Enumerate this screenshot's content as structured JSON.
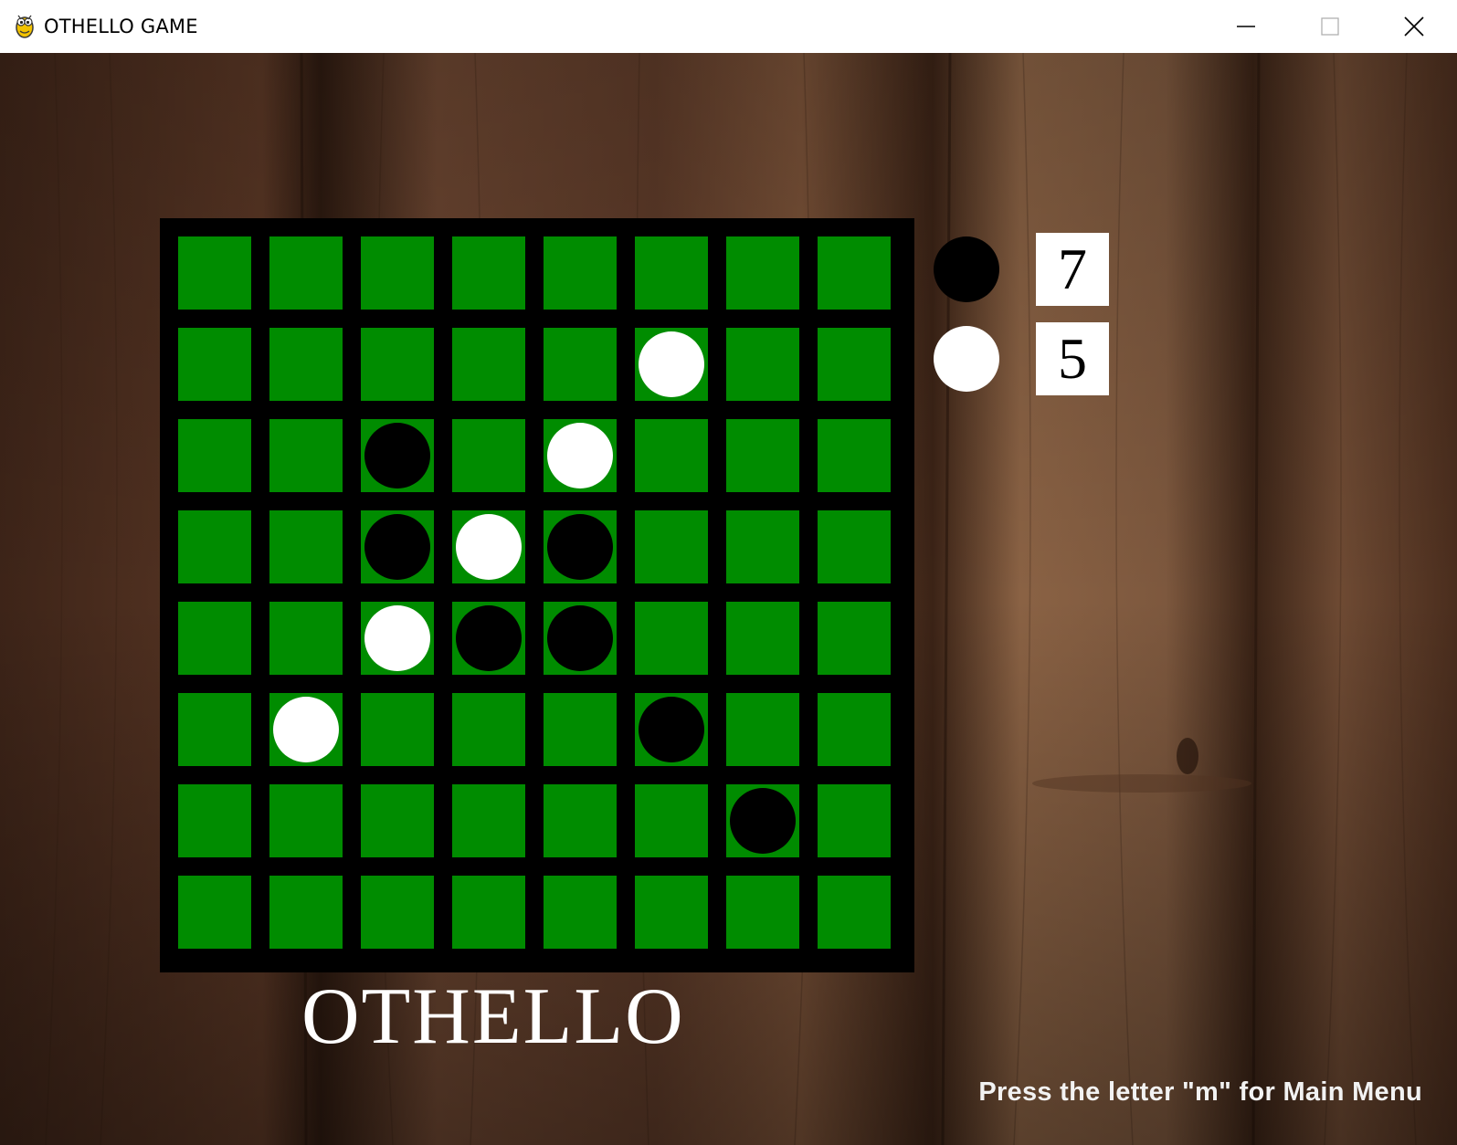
{
  "window": {
    "title": "OTHELLO GAME",
    "icon": "pygame-snake-icon",
    "controls": {
      "minimize": "minimize-icon",
      "maximize": "maximize-icon",
      "close": "close-icon"
    }
  },
  "colors": {
    "board_border": "#000000",
    "cell": "#008c00",
    "black_disc": "#000000",
    "white_disc": "#ffffff",
    "wood_dark": "#3a2215",
    "wood_mid": "#6b4530",
    "wood_light": "#8a6346"
  },
  "board": {
    "size": 8,
    "rows": [
      "--------",
      "-----W--",
      "--B-W---",
      "--BWB---",
      "--WBB---",
      "-W---B--",
      "------B-",
      "--------"
    ],
    "legend": {
      "B": "black",
      "W": "white",
      "-": "empty"
    }
  },
  "score": {
    "black": "7",
    "white": "5"
  },
  "title": "OTHELLO",
  "hint": "Press the letter \"m\" for Main Menu"
}
